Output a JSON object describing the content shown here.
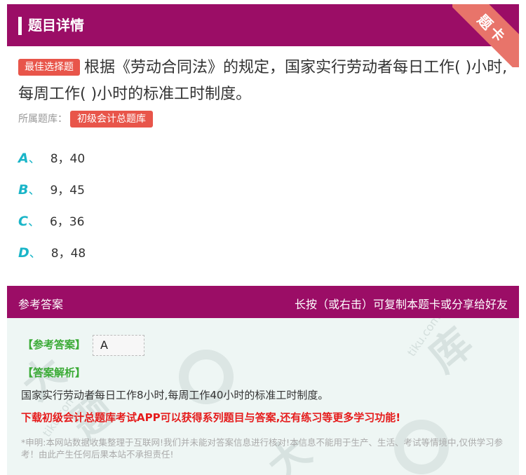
{
  "header": {
    "title": "题目详情",
    "ribbon": "题卡"
  },
  "question": {
    "tag": "最佳选择题",
    "text": "根据《劳动合同法》的规定，国家实行劳动者每日工作( )小时,每周工作( )小时的标准工时制度。",
    "bank_label": "所属题库：",
    "bank_name": "初级会计总题库"
  },
  "options": [
    {
      "letter": "A",
      "sep": "、",
      "text": "8，40"
    },
    {
      "letter": "B",
      "sep": "、",
      "text": "9，45"
    },
    {
      "letter": "C",
      "sep": "、",
      "text": "6，36"
    },
    {
      "letter": "D",
      "sep": "、",
      "text": "8，48"
    }
  ],
  "answer_section": {
    "title": "参考答案",
    "hint": "长按（或右击）可复制本题卡或分享给好友",
    "ref_label": "【参考答案】",
    "ref_value": "A",
    "analysis_label": "【答案解析】",
    "analysis_text": "国家实行劳动者每日工作8小时,每周工作40小时的标准工时制度。",
    "promo": "下载初级会计总题库考试APP可以获得系列题目与答案,还有练习等更多学习功能!",
    "notice": "*申明:本网站数据收集整理于互联网!我们并未能对答案信息进行核对!本信息不能用于生产、生活、考试等情境中,仅供学习参考！由此产生任何后果本站不承担责任!"
  },
  "colors": {
    "brand": "#9b0d66",
    "accent": "#1ab5c8",
    "tag": "#e8554a",
    "answer_green": "#3aaa35",
    "promo_red": "#e51c1c"
  }
}
